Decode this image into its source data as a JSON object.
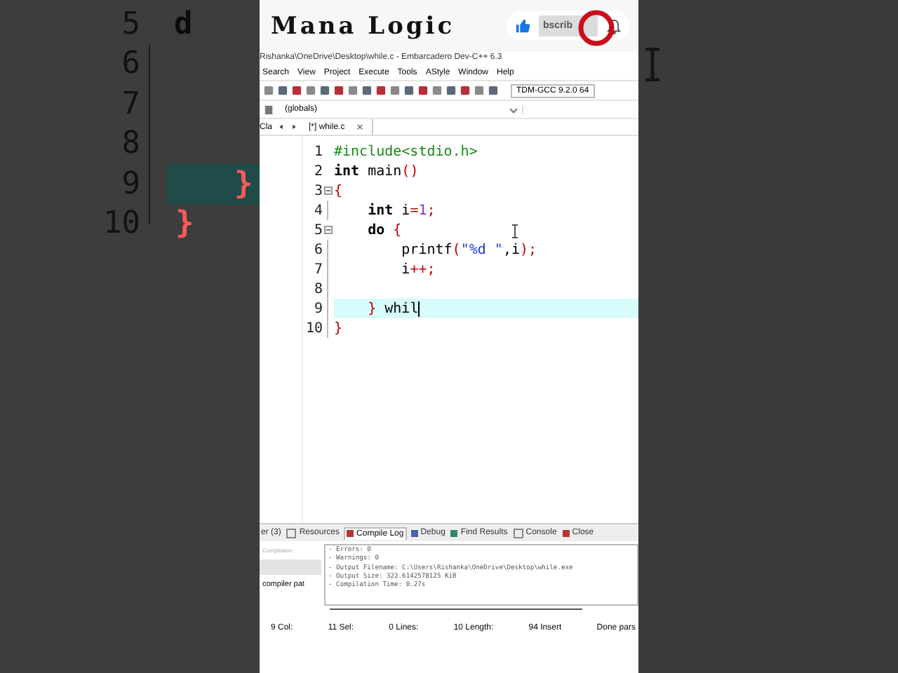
{
  "background_left": {
    "lines": [
      {
        "number": "5",
        "code": "d",
        "kind": "keyword",
        "current": false
      },
      {
        "number": "6",
        "current": false
      },
      {
        "number": "7",
        "current": false
      },
      {
        "number": "8",
        "current": false
      },
      {
        "number": "9",
        "code": "}",
        "kind": "brace",
        "current": true
      },
      {
        "number": "10",
        "code": "}",
        "kind": "brace",
        "current": false
      }
    ]
  },
  "channel": {
    "name": "Mana Logic",
    "subscribe_label": "bscrib"
  },
  "window": {
    "title": "Rishanka\\OneDrive\\Desktop\\while.c - Embarcadero Dev-C++ 6.3"
  },
  "menu": [
    "Search",
    "View",
    "Project",
    "Execute",
    "Tools",
    "AStyle",
    "Window",
    "Help"
  ],
  "toolbar": {
    "compiler": "TDM-GCC 9.2.0 64"
  },
  "scope": {
    "value": "(globals)"
  },
  "side_tab": "Cla",
  "tabs": [
    {
      "label": "[*] while.c",
      "selected": true
    }
  ],
  "editor": {
    "lines": [
      {
        "number": "1",
        "foldable": false,
        "current": false,
        "tokens": [
          {
            "text": "#include<stdio.h>",
            "kind": "preproc"
          }
        ]
      },
      {
        "number": "2",
        "foldable": false,
        "current": false,
        "tokens": [
          {
            "text": "int",
            "kind": "keyword"
          },
          {
            "text": " main",
            "kind": "plain"
          },
          {
            "text": "()",
            "kind": "symbol"
          }
        ]
      },
      {
        "number": "3",
        "foldable": true,
        "current": false,
        "tokens": [
          {
            "text": "{",
            "kind": "symbol"
          }
        ]
      },
      {
        "number": "4",
        "foldable": false,
        "current": false,
        "tokens": [
          {
            "text": "    int",
            "kind": "keyword"
          },
          {
            "text": " i",
            "kind": "plain"
          },
          {
            "text": "=",
            "kind": "symbol"
          },
          {
            "text": "1",
            "kind": "number"
          },
          {
            "text": ";",
            "kind": "symbol"
          }
        ]
      },
      {
        "number": "5",
        "foldable": true,
        "current": false,
        "tokens": [
          {
            "text": "    do",
            "kind": "keyword"
          },
          {
            "text": " {",
            "kind": "symbol"
          }
        ]
      },
      {
        "number": "6",
        "foldable": false,
        "current": false,
        "tokens": [
          {
            "text": "        printf",
            "kind": "plain"
          },
          {
            "text": "(",
            "kind": "symbol"
          },
          {
            "text": "\"%d \"",
            "kind": "string"
          },
          {
            "text": ",i",
            "kind": "plain"
          },
          {
            "text": ");",
            "kind": "symbol"
          }
        ]
      },
      {
        "number": "7",
        "foldable": false,
        "current": false,
        "tokens": [
          {
            "text": "        i",
            "kind": "plain"
          },
          {
            "text": "++;",
            "kind": "symbol"
          }
        ]
      },
      {
        "number": "8",
        "foldable": false,
        "current": false
      },
      {
        "number": "9",
        "foldable": false,
        "current": true,
        "tokens": [
          {
            "text": "    }",
            "kind": "symbol"
          },
          {
            "text": " whil",
            "kind": "plain"
          }
        ]
      },
      {
        "number": "10",
        "foldable": false,
        "current": false,
        "tokens": [
          {
            "text": "}",
            "kind": "symbol"
          }
        ]
      }
    ]
  },
  "bottom_tabs": [
    {
      "label": "er (3)",
      "selected": false
    },
    {
      "label": "Resources",
      "selected": false
    },
    {
      "label": "Compile Log",
      "selected": true
    },
    {
      "label": "Debug",
      "selected": false
    },
    {
      "label": "Find Results",
      "selected": false
    },
    {
      "label": "Console",
      "selected": false
    },
    {
      "label": "Close",
      "selected": false
    }
  ],
  "log_side": {
    "heading": "Compilation",
    "option": "compiler pat"
  },
  "compile_log": [
    "- Errors: 0",
    "- Warnings: 0",
    "- Output Filename: C:\\Users\\Rishanka\\OneDrive\\Desktop\\while.exe",
    "- Output Size: 322.6142578125 KiB",
    "- Compilation Time: 0.27s"
  ],
  "status_bar": [
    "9 Col:",
    "11 Sel:",
    "0 Lines:",
    "10 Length:",
    "94 Insert",
    "Done pars"
  ]
}
